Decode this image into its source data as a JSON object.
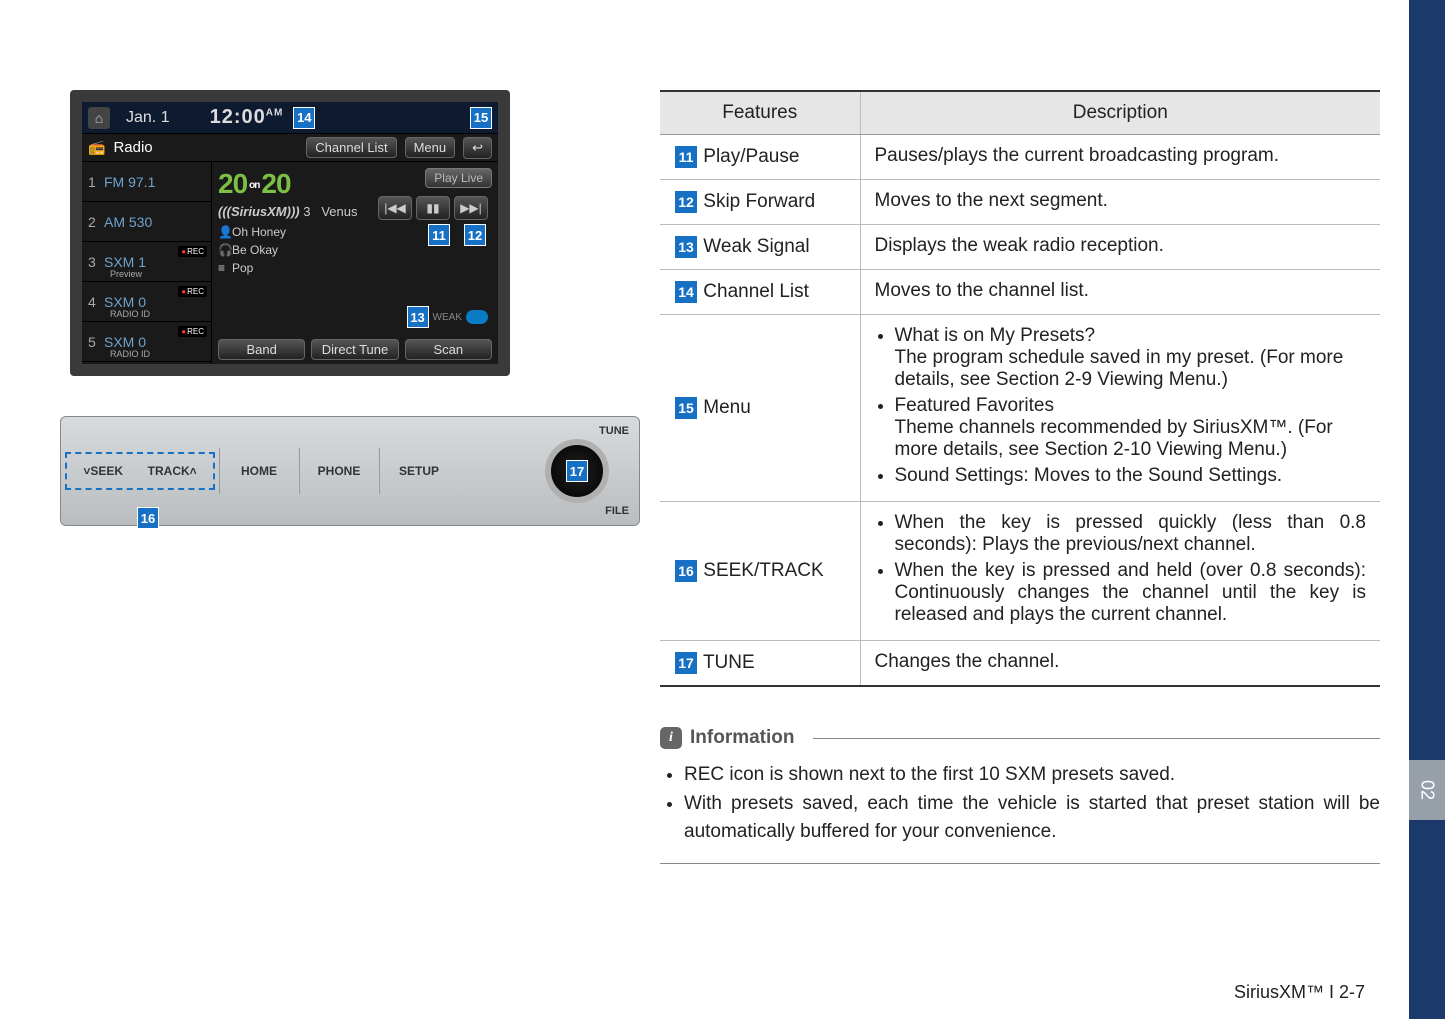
{
  "screenshot": {
    "topbar": {
      "date": "Jan.  1",
      "time": "12:00",
      "ampm": "AM"
    },
    "callouts": {
      "c14": "14",
      "c15": "15",
      "c11": "11",
      "c12": "12",
      "c13": "13",
      "c16": "16",
      "c17": "17"
    },
    "menubar": {
      "radio": "Radio",
      "channel_list": "Channel List",
      "menu": "Menu"
    },
    "presets": [
      {
        "num": "1",
        "label": "FM 97.1",
        "sub": "",
        "rec": false
      },
      {
        "num": "2",
        "label": "AM 530",
        "sub": "",
        "rec": false
      },
      {
        "num": "3",
        "label": "SXM 1",
        "sub": "Preview",
        "rec": true
      },
      {
        "num": "4",
        "label": "SXM 0",
        "sub": "RADIO ID",
        "rec": true
      },
      {
        "num": "5",
        "label": "SXM 0",
        "sub": "RADIO ID",
        "rec": true
      }
    ],
    "main": {
      "play_live": "Play Live",
      "logo_left": "20",
      "logo_on": "on",
      "logo_right": "20",
      "sxm_logo": "(((SiriusXM)))",
      "ch_num": "3",
      "ch_name": "Venus",
      "artist": "Oh Honey",
      "title": "Be Okay",
      "genre": "Pop",
      "weak": "WEAK"
    },
    "bottom": {
      "band": "Band",
      "direct": "Direct Tune",
      "scan": "Scan"
    }
  },
  "hardware": {
    "seek": "SEEK",
    "track": "TRACK",
    "home": "HOME",
    "phone": "PHONE",
    "setup": "SETUP",
    "tune": "TUNE",
    "file": "FILE"
  },
  "table": {
    "head_feature": "Features",
    "head_desc": "Description",
    "rows": {
      "r11": {
        "num": "11",
        "name": "Play/Pause",
        "desc": "Pauses/plays the current broadcasting program."
      },
      "r12": {
        "num": "12",
        "name": "Skip Forward",
        "desc": "Moves to the next segment."
      },
      "r13": {
        "num": "13",
        "name": "Weak Signal",
        "desc": "Displays the weak radio reception."
      },
      "r14": {
        "num": "14",
        "name": "Channel List",
        "desc": "Moves to the channel list."
      },
      "r15": {
        "num": "15",
        "name": "Menu",
        "b1a": "What is on My Presets?",
        "b1b": "The program schedule saved in my preset. (For more details, see Section 2-9 Viewing Menu.)",
        "b2a": "Featured Favorites",
        "b2b": "Theme channels recommended by SiriusXM™. (For more details, see Section 2-10 Viewing Menu.)",
        "b3": "Sound Settings: Moves to the Sound Settings."
      },
      "r16": {
        "num": "16",
        "name": "SEEK/TRACK",
        "b1": "When the key is pressed quickly (less than 0.8 seconds): Plays the previous/next channel.",
        "b2": "When the key is pressed and held (over 0.8 seconds): Continuously changes the channel until the key is released and plays the current channel."
      },
      "r17": {
        "num": "17",
        "name": "TUNE",
        "desc": "Changes the channel."
      }
    }
  },
  "info": {
    "heading": "Information",
    "b1": "REC icon is shown next to the first 10 SXM presets saved.",
    "b2": "With presets saved, each time the vehicle is started that preset station will be automatically buffered for your convenience."
  },
  "footer": "SiriusXM™ I 2-7",
  "side_section": "02"
}
